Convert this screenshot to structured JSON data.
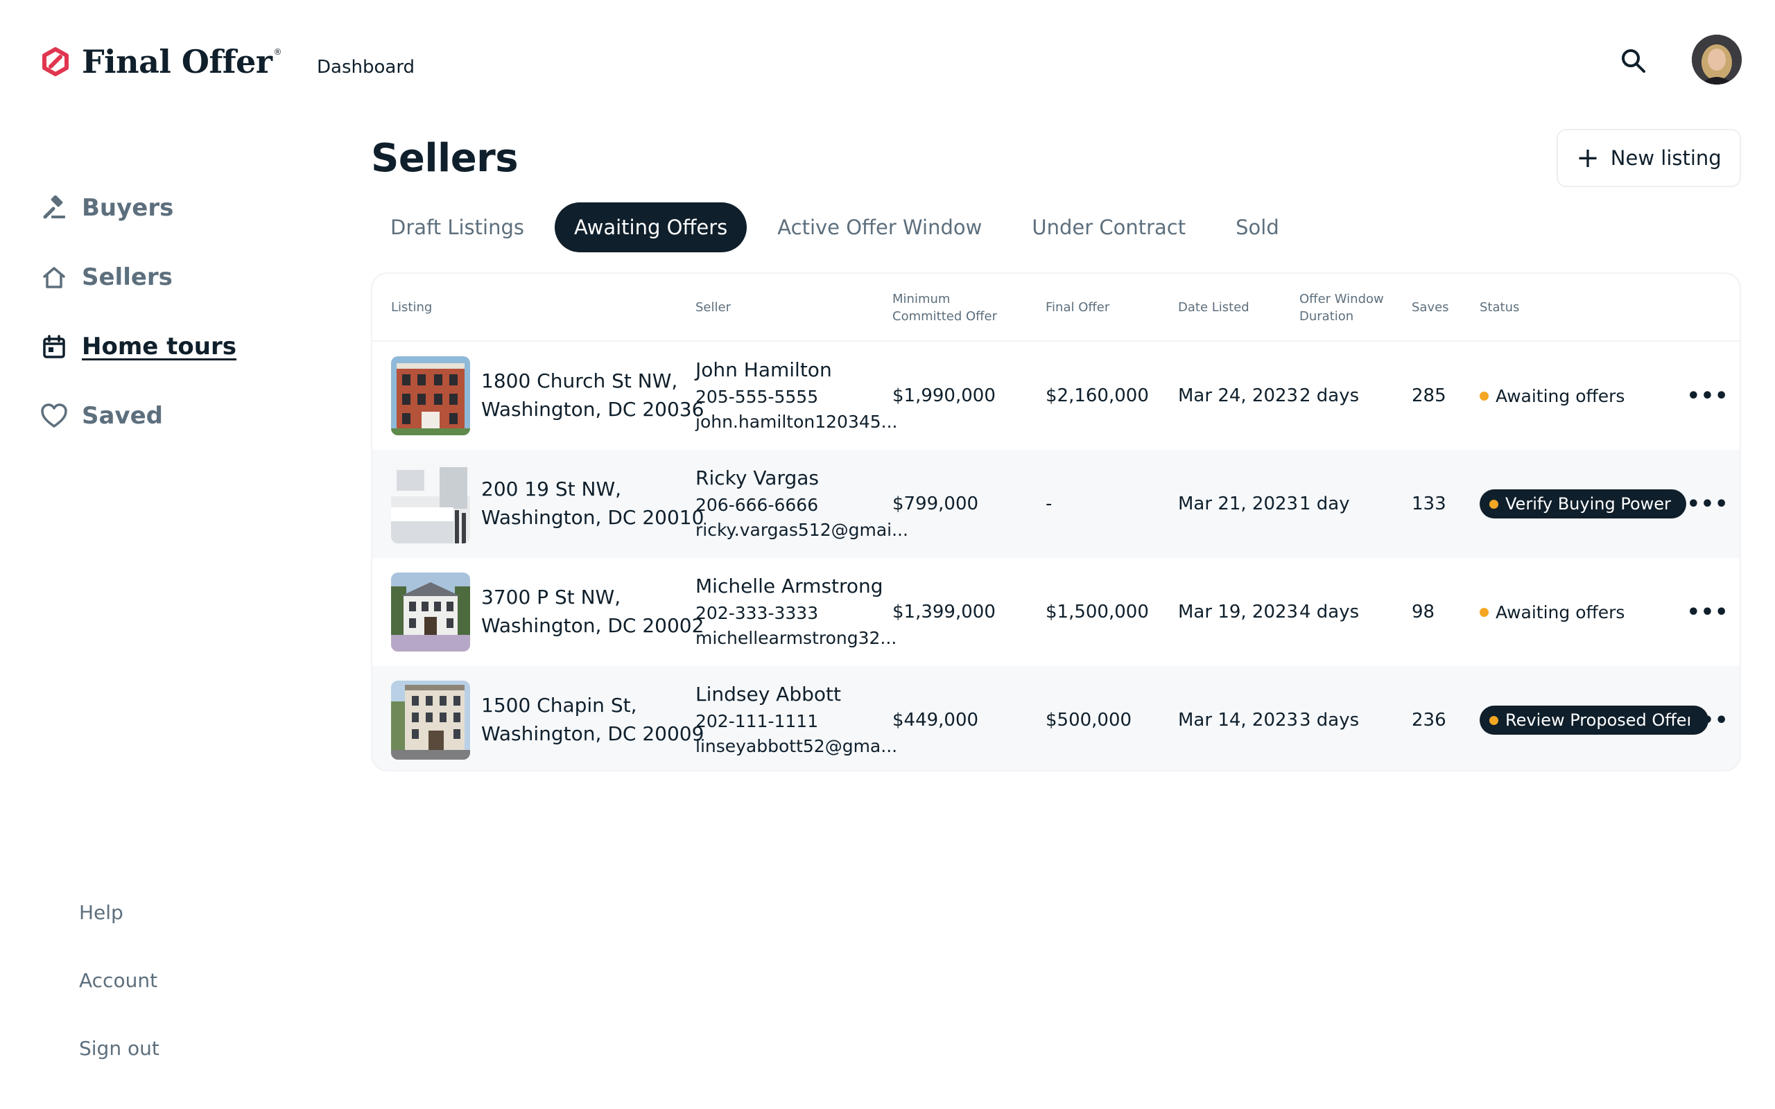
{
  "brand": {
    "name": "Final Offer",
    "registered": "®",
    "accent": "#e0364f"
  },
  "header": {
    "dashboard_link": "Dashboard"
  },
  "sidebar": {
    "items": [
      {
        "label": "Buyers",
        "icon": "gavel-icon"
      },
      {
        "label": "Sellers",
        "icon": "house-icon"
      },
      {
        "label": "Home tours",
        "icon": "calendar-icon",
        "active": true
      },
      {
        "label": "Saved",
        "icon": "heart-icon"
      }
    ],
    "footer": [
      "Help",
      "Account",
      "Sign out"
    ]
  },
  "main": {
    "title": "Sellers",
    "new_listing_label": "New listing",
    "tabs": [
      "Draft Listings",
      "Awaiting Offers",
      "Active Offer Window",
      "Under Contract",
      "Sold"
    ],
    "active_tab": "Awaiting Offers",
    "columns": {
      "listing": "Listing",
      "seller": "Seller",
      "min_offer_1": "Minimum",
      "min_offer_2": "Committed Offer",
      "final_offer": "Final Offer",
      "date_listed": "Date Listed",
      "duration_1": "Offer Window",
      "duration_2": "Duration",
      "saves": "Saves",
      "status": "Status"
    },
    "rows": [
      {
        "addr1": "1800 Church St NW,",
        "addr2": "Washington, DC 20036",
        "seller_name": "John Hamilton",
        "seller_phone": "205-555-5555",
        "seller_email": "john.hamilton120345...",
        "min_offer": "$1,990,000",
        "final_offer": "$2,160,000",
        "date_listed": "Mar 24, 2023",
        "duration": "2 days",
        "saves": "285",
        "status": "Awaiting offers"
      },
      {
        "addr1": "200 19 St NW,",
        "addr2": "Washington, DC 20010",
        "seller_name": "Ricky Vargas",
        "seller_phone": "206-666-6666",
        "seller_email": "ricky.vargas512@gmai...",
        "min_offer": "$799,000",
        "final_offer": "-",
        "date_listed": "Mar 21, 2023",
        "duration": "1 day",
        "saves": "133",
        "status": "Verify Buying Power"
      },
      {
        "addr1": "3700 P St NW,",
        "addr2": "Washington, DC 20002",
        "seller_name": "Michelle Armstrong",
        "seller_phone": "202-333-3333",
        "seller_email": "michellearmstrong32...",
        "min_offer": "$1,399,000",
        "final_offer": "$1,500,000",
        "date_listed": "Mar 19, 2023",
        "duration": "4 days",
        "saves": "98",
        "status": "Awaiting offers"
      },
      {
        "addr1": "1500 Chapin St,",
        "addr2": "Washington, DC 20009",
        "seller_name": "Lindsey Abbott",
        "seller_phone": "202-111-1111",
        "seller_email": "linseyabbott52@gma...",
        "min_offer": "$449,000",
        "final_offer": "$500,000",
        "date_listed": "Mar 14, 2023",
        "duration": "3 days",
        "saves": "236",
        "status": "Review Proposed Offer"
      }
    ]
  }
}
